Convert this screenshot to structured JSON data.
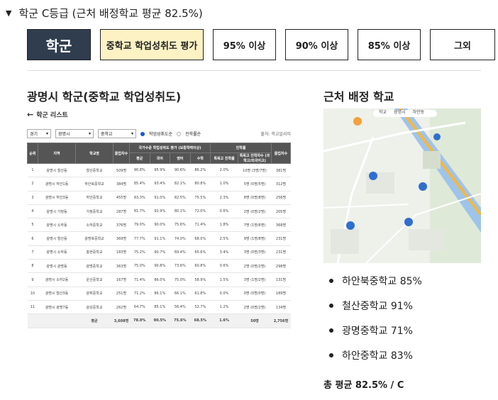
{
  "header": {
    "title": "학군 C등급 (근처 배정학교 평균 82.5%)"
  },
  "tabs": [
    {
      "label": "학군"
    },
    {
      "label": "중학교 학업성취도 평가"
    },
    {
      "label": "95% 이상"
    },
    {
      "label": "90% 이상"
    },
    {
      "label": "85% 이상"
    },
    {
      "label": "그외"
    }
  ],
  "left": {
    "title": "광명시 학군(중학교 학업성취도)",
    "back_label": "학군 리스트",
    "filters": {
      "region": "경기",
      "city": "광명시",
      "level": "중학교",
      "radio_a": "학업성취도순",
      "radio_b": "진학률순",
      "source": "출처: 학교알리미"
    },
    "table": {
      "group_headers": {
        "achievement": "국가수준 학업성취도 평가 (보통학력이상)",
        "progress": "진학률"
      },
      "headers": [
        "순위",
        "지역",
        "학교명",
        "졸업자수",
        "평균",
        "국어",
        "영어",
        "수학",
        "특목고 진학률",
        "특목고 진학자수 (과학고/외국어고)",
        "졸업자수"
      ],
      "rows": [
        [
          "1",
          "광명시 철산동",
          "철산중학교",
          "509명",
          "90.8%",
          "95.9%",
          "90.6%",
          "86.2%",
          "2.0%",
          "10명 (3명/7명)",
          "381명"
        ],
        [
          "2",
          "광명시 하안1동",
          "하안북중학교",
          "384명",
          "85.4%",
          "93.4%",
          "82.1%",
          "80.8%",
          "1.0%",
          "5명 (0명/5명)",
          "312명"
        ],
        [
          "3",
          "광명시 하안3동",
          "하안중학교",
          "455명",
          "83.3%",
          "91.0%",
          "82.5%",
          "75.5%",
          "2.3%",
          "8명 (0명/8명)",
          "256명"
        ],
        [
          "4",
          "광명시 가정동",
          "가정중학교",
          "287명",
          "81.7%",
          "92.9%",
          "80.1%",
          "72.0%",
          "0.6%",
          "2명 (0명/2명)",
          "205명"
        ],
        [
          "5",
          "광명시 소하동",
          "소하중학교",
          "376명",
          "79.0%",
          "90.0%",
          "75.6%",
          "71.4%",
          "1.8%",
          "7명 (1명/6명)",
          "368명"
        ],
        [
          "6",
          "광명시 철산동",
          "광명북중학교",
          "369명",
          "77.7%",
          "91.1%",
          "74.0%",
          "68.0%",
          "2.5%",
          "9명 (1명/8명)",
          "231명"
        ],
        [
          "7",
          "광명시 소하동",
          "충현중학교",
          "183명",
          "75.2%",
          "90.7%",
          "69.4%",
          "65.6%",
          "3.4%",
          "3명 (0명/3명)",
          "231명"
        ],
        [
          "8",
          "광명시 광명동",
          "광명중학교",
          "363명",
          "75.0%",
          "90.8%",
          "73.6%",
          "60.8%",
          "0.6%",
          "2명 (0명/2명)",
          "298명"
        ],
        [
          "9",
          "광명시 소하2동",
          "운산중학교",
          "167명",
          "71.4%",
          "86.0%",
          "75.0%",
          "58.9%",
          "1.5%",
          "3명 (1명/2명)",
          "131명"
        ],
        [
          "10",
          "광명시 철산3동",
          "광휘중학교",
          "251명",
          "71.2%",
          "86.1%",
          "66.1%",
          "61.8%",
          "0.0%",
          "0명 (0명/0명)",
          "189명"
        ],
        [
          "11",
          "광명시 광명7동",
          "광성중학교",
          "262명",
          "64.7%",
          "85.1%",
          "56.4%",
          "52.7%",
          "1.2%",
          "2명 (0명/2명)",
          "134명"
        ]
      ],
      "avg_row": [
        "",
        "",
        "평균",
        "3,608명",
        "78.0%",
        "90.5%",
        "75.6%",
        "68.5%",
        "1.6%",
        "50명",
        "2,756명"
      ]
    }
  },
  "right": {
    "title": "근처 배정 학교",
    "map_tabs": [
      "학교",
      "광명시",
      "하안동"
    ],
    "schools": [
      {
        "label": "하안북중학교 85%"
      },
      {
        "label": "철산중학교 91%"
      },
      {
        "label": "광명중학교 71%"
      },
      {
        "label": "하안중학교 83%"
      }
    ],
    "total": "총 평균 82.5% / C"
  },
  "colors": {
    "dark_tab": "#2f3d4f",
    "yellow_tab": "#fdf2c4",
    "table_header": "#555555",
    "radio_accent": "#1a56d6",
    "map_river": "#9fc4ea",
    "map_road": "#f4b73f"
  },
  "icons": [
    "triangle-down-icon",
    "back-arrow-icon",
    "dropdown-chevron-icon",
    "radio-checked-icon",
    "radio-unchecked-icon",
    "map-pin-icon",
    "bullet-dot-icon"
  ]
}
